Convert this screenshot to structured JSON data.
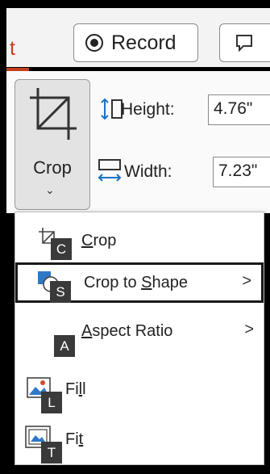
{
  "ribbon": {
    "tab_partial": "t",
    "record_button": "Record",
    "crop_label": "Crop",
    "height_label": "Height:",
    "height_value": "4.76\"",
    "width_label": "Width:",
    "width_value": "7.23\""
  },
  "menu": {
    "items": [
      {
        "pre": "",
        "u": "C",
        "post": "rop",
        "key": "C"
      },
      {
        "pre": "Crop to ",
        "u": "S",
        "post": "hape",
        "key": "S"
      },
      {
        "pre": "",
        "u": "A",
        "post": "spect Ratio",
        "key": "A"
      },
      {
        "pre": "Fi",
        "u": "l",
        "post": "l",
        "key": "L"
      },
      {
        "pre": "Fi",
        "u": "t",
        "post": "",
        "key": "T"
      }
    ],
    "submenu_arrow": ">"
  },
  "colors": {
    "accent": "#c43e1c",
    "keytip_bg": "#3a3a3a",
    "selected_border": "#1a1a1a"
  },
  "icons": [
    "record-icon",
    "comment-icon",
    "crop-icon",
    "height-icon",
    "width-icon",
    "crop-small-icon",
    "crop-shape-icon",
    "fill-icon",
    "fit-icon"
  ]
}
